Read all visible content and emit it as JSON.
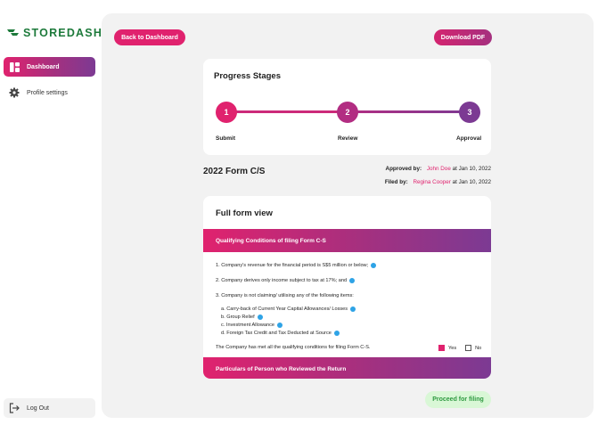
{
  "brand": {
    "name": "STOREDASH",
    "color": "#1d7a3b"
  },
  "sidebar": {
    "items": [
      {
        "label": "Dashboard",
        "icon": "dashboard-icon",
        "active": true
      },
      {
        "label": "Profile settings",
        "icon": "gear-icon",
        "active": false
      }
    ],
    "logout": {
      "label": "Log Out",
      "icon": "logout-icon"
    }
  },
  "toolbar": {
    "back_label": "Back to Dashboard",
    "download_label": "Download PDF"
  },
  "progress": {
    "title": "Progress Stages",
    "steps": [
      {
        "number": "1",
        "label": "Submit"
      },
      {
        "number": "2",
        "label": "Review"
      },
      {
        "number": "3",
        "label": "Approval"
      }
    ]
  },
  "form": {
    "title": "2022 Form C/S",
    "approved_label": "Approved by:",
    "approved_by": "John Doe",
    "approved_at": "at Jan 10, 2022",
    "filed_label": "Filed by:",
    "filed_by": "Regina Cooper",
    "filed_at": "at Jan 10, 2022"
  },
  "full_form": {
    "title": "Full form view",
    "section1_title": "Qualifying Conditions of filing Form C-S",
    "conditions": [
      "1. Company's revenue for the financial period is S$5 million or below;",
      "2. Company derives only income subject to tax at 17%; and",
      "3. Company is not claiming/ utilising any of the following items:"
    ],
    "sub_items": [
      "a. Carry-back of Current Year Capital Allowances/ Losses",
      "b. Group Relief",
      "c. Investment Allowance",
      "d. Foreign Tax Credit and Tax Deducted at Source"
    ],
    "met_statement": "The Company has met all the qualifying conditions for filing Form C-S.",
    "yes_label": "Yes",
    "no_label": "No",
    "section2_title": "Particulars of Person who Reviewed the Return"
  },
  "actions": {
    "proceed_label": "Proceed for filing"
  },
  "colors": {
    "accent": "#e0226e",
    "purple": "#7c3a93",
    "info": "#2ea3e6",
    "success_bg": "#d9f7d6",
    "success_text": "#2f9a41"
  }
}
